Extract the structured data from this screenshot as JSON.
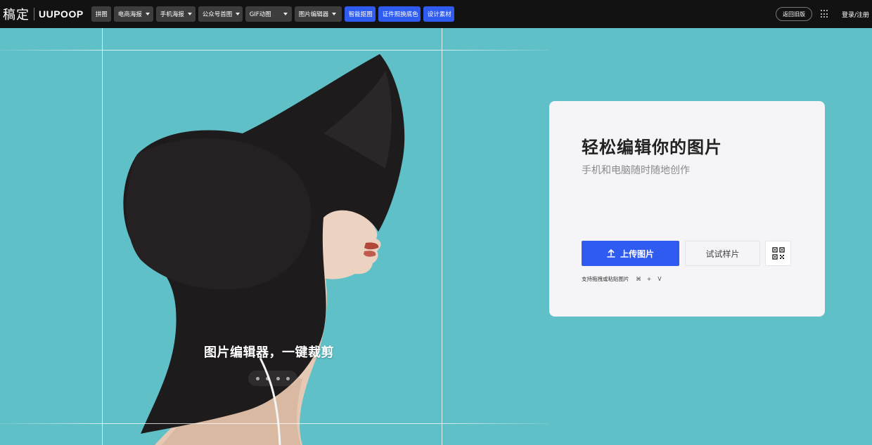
{
  "logo": {
    "cn": "稿定",
    "en": "UUPOOP"
  },
  "nav": {
    "items": [
      {
        "label": "拼图",
        "dropdown": false,
        "style": "dark"
      },
      {
        "label": "电商海报",
        "dropdown": true,
        "style": "dark"
      },
      {
        "label": "手机海报",
        "dropdown": true,
        "style": "dark"
      },
      {
        "label": "公众号首图",
        "dropdown": true,
        "style": "dark"
      },
      {
        "label": "GIF动图",
        "dropdown": true,
        "style": "dark"
      },
      {
        "label": "图片编辑器",
        "dropdown": true,
        "style": "dark"
      },
      {
        "label": "智能抠图",
        "dropdown": false,
        "style": "blue"
      },
      {
        "label": "证件照换底色",
        "dropdown": false,
        "style": "blue"
      },
      {
        "label": "设计素材",
        "dropdown": false,
        "style": "blue"
      }
    ]
  },
  "topbar": {
    "old_version": "返回旧版",
    "apps_icon": "grid-icon",
    "login": "登录/注册"
  },
  "hero": {
    "caption": "图片编辑器，一键裁剪",
    "carousel_dots": 4,
    "background_color": "#5fc0c8"
  },
  "card": {
    "title": "轻松编辑你的图片",
    "subtitle": "手机和电脑随时随地创作",
    "upload_label": "上传图片",
    "upload_icon": "upload-icon",
    "sample_label": "试试样片",
    "qr_icon": "qrcode-icon",
    "hint": "支持拖拽或粘贴图片",
    "shortcut": [
      "⌘",
      "+",
      "V"
    ]
  },
  "colors": {
    "accent": "#2f5bf0",
    "topbar": "#121212",
    "nav_button": "#3d3d3d"
  }
}
